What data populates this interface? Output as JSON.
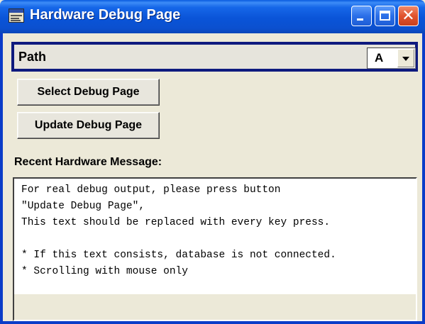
{
  "window": {
    "title": "Hardware Debug Page",
    "icon": "debug-page-icon",
    "controls": {
      "minimize": "minimize-icon",
      "maximize": "maximize-icon",
      "close": "close-icon",
      "close_glyph": "✕"
    },
    "frame_color": "#0a3cc8",
    "titlebar_color": "#0a54d8",
    "close_color": "#e0542e"
  },
  "path": {
    "label": "Path",
    "selected": "A"
  },
  "buttons": {
    "select_debug_page": "Select Debug Page",
    "update_debug_page": "Update Debug Page"
  },
  "message": {
    "label": "Recent Hardware Message:",
    "lines": [
      "For real debug output, please press button",
      "\"Update Debug Page\",",
      "This text should be replaced with every key press.",
      "",
      "* If this text consists, database is not connected.",
      "* Scrolling with mouse only"
    ]
  }
}
